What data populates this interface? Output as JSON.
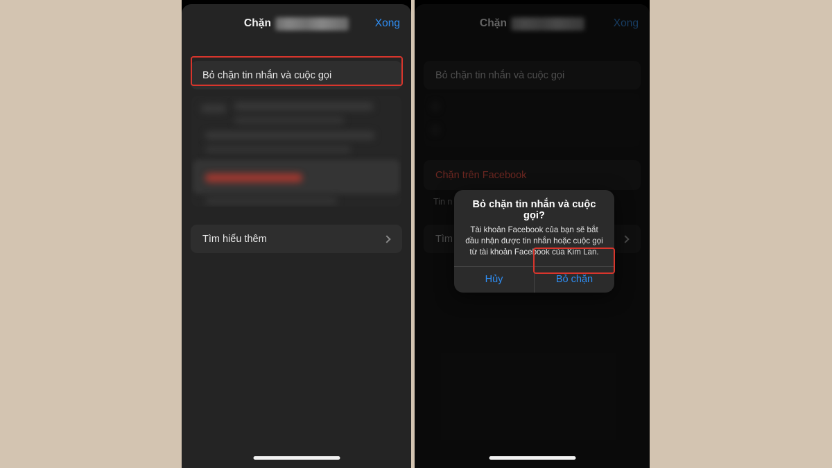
{
  "page": {
    "background_color": "#d3c4b1",
    "highlight_color": "#d8352c",
    "accent_blue": "#2f8ef4",
    "destructive_red": "#c4473c"
  },
  "screen_left": {
    "navbar": {
      "title_prefix": "Chặn",
      "title_redacted": true,
      "done_label": "Xong"
    },
    "rows": [
      {
        "name": "unblock-messages-calls",
        "label": "Bỏ chặn tin nhắn và cuộc gọi",
        "highlighted": true
      },
      {
        "name": "learn-more",
        "label": "Tìm hiểu thêm",
        "chevron": true
      }
    ],
    "censored_block": {
      "label": "blurred-content-region",
      "has_red_text": true
    }
  },
  "screen_right": {
    "navbar": {
      "title_prefix": "Chặn",
      "title_redacted": true,
      "done_label": "Xong"
    },
    "rows": [
      {
        "name": "unblock-messages-calls",
        "label": "Bỏ chặn tin nhắn và cuộc gọi"
      },
      {
        "name": "block-on-facebook",
        "label": "Chặn trên Facebook",
        "destructive": true
      },
      {
        "name": "block-subtitle",
        "label": "Tin n"
      },
      {
        "name": "learn-more",
        "label": "Tìm",
        "chevron": true
      }
    ],
    "censored_block": {
      "label": "blurred-content-region"
    },
    "alert": {
      "title": "Bỏ chặn tin nhắn và cuộc gọi?",
      "message": "Tài khoản Facebook của bạn sẽ bắt đầu nhận được tin nhắn hoặc cuộc gọi từ tài khoản Facebook của Kim Lan.",
      "cancel_label": "Hủy",
      "confirm_label": "Bỏ chặn",
      "confirm_highlighted": true
    }
  }
}
